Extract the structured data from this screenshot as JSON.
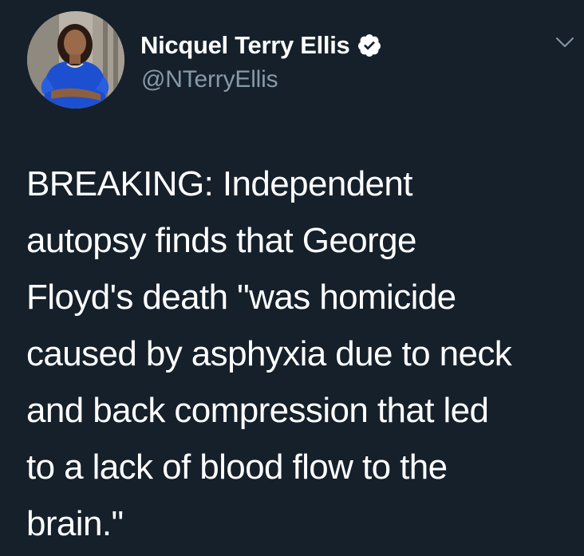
{
  "author": {
    "name": "Nicquel Terry Ellis",
    "handle": "@NTerryEllis",
    "verified_icon": "verified-badge-icon",
    "avatar": "profile-photo"
  },
  "menu": {
    "icon": "chevron-down-icon"
  },
  "tweet": {
    "text": "BREAKING: Independent\nautopsy finds that George\nFloyd's death \"was homicide\ncaused by asphyxia due to neck\nand back compression that led\nto a lack of blood flow to the\nbrain.\""
  },
  "colors": {
    "background": "#15202b",
    "text": "#ffffff",
    "secondary_text": "#8899a6",
    "chevron": "#8899a6"
  }
}
